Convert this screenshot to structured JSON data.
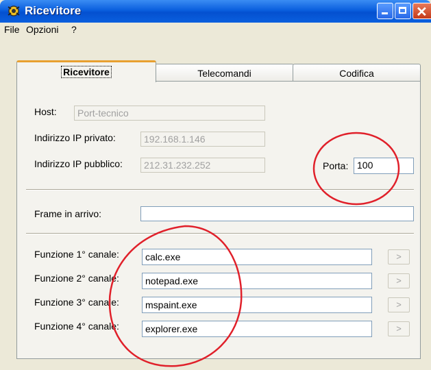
{
  "window": {
    "title": "Ricevitore",
    "annotation_color": "#e0202a",
    "titlebar_color": "#0a5fde"
  },
  "menu": {
    "items": [
      "File",
      "Opzioni",
      "?"
    ]
  },
  "tabs": [
    "Ricevitore",
    "Telecomandi",
    "Codifica"
  ],
  "form": {
    "host_label": "Host:",
    "host_value": "Port-tecnico",
    "ip_private_label": "Indirizzo IP privato:",
    "ip_private_value": "192.168.1.146",
    "ip_public_label": "Indirizzo IP pubblico:",
    "ip_public_value": "212.31.232.252",
    "port_label": "Porta:",
    "port_value": "100",
    "frame_label": "Frame in arrivo:",
    "frame_value": "",
    "channels": [
      {
        "label": "Funzione 1° canale:",
        "value": "calc.exe",
        "button": ">"
      },
      {
        "label": "Funzione 2° canale:",
        "value": "notepad.exe",
        "button": ">"
      },
      {
        "label": "Funzione 3° canale:",
        "value": "mspaint.exe",
        "button": ">"
      },
      {
        "label": "Funzione 4° canale:",
        "value": "explorer.exe",
        "button": ">"
      }
    ]
  }
}
